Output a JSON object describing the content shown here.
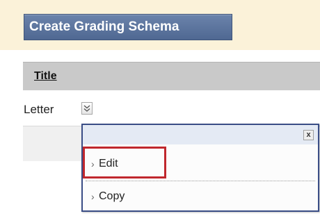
{
  "toolbar": {
    "create_button_label": "Create Grading Schema"
  },
  "table": {
    "column_title": "Title",
    "rows": [
      {
        "title": "Letter"
      }
    ]
  },
  "context_menu": {
    "close_label": "x",
    "items": [
      {
        "arrow": "›",
        "label": "Edit",
        "highlighted": true
      },
      {
        "arrow": "›",
        "label": "Copy",
        "highlighted": false
      }
    ]
  },
  "colors": {
    "top_band": "#fbf2d9",
    "button": "#5a729c",
    "header_bar": "#c9c9c9",
    "menu_border": "#3a4d86",
    "highlight": "#c0272d"
  }
}
